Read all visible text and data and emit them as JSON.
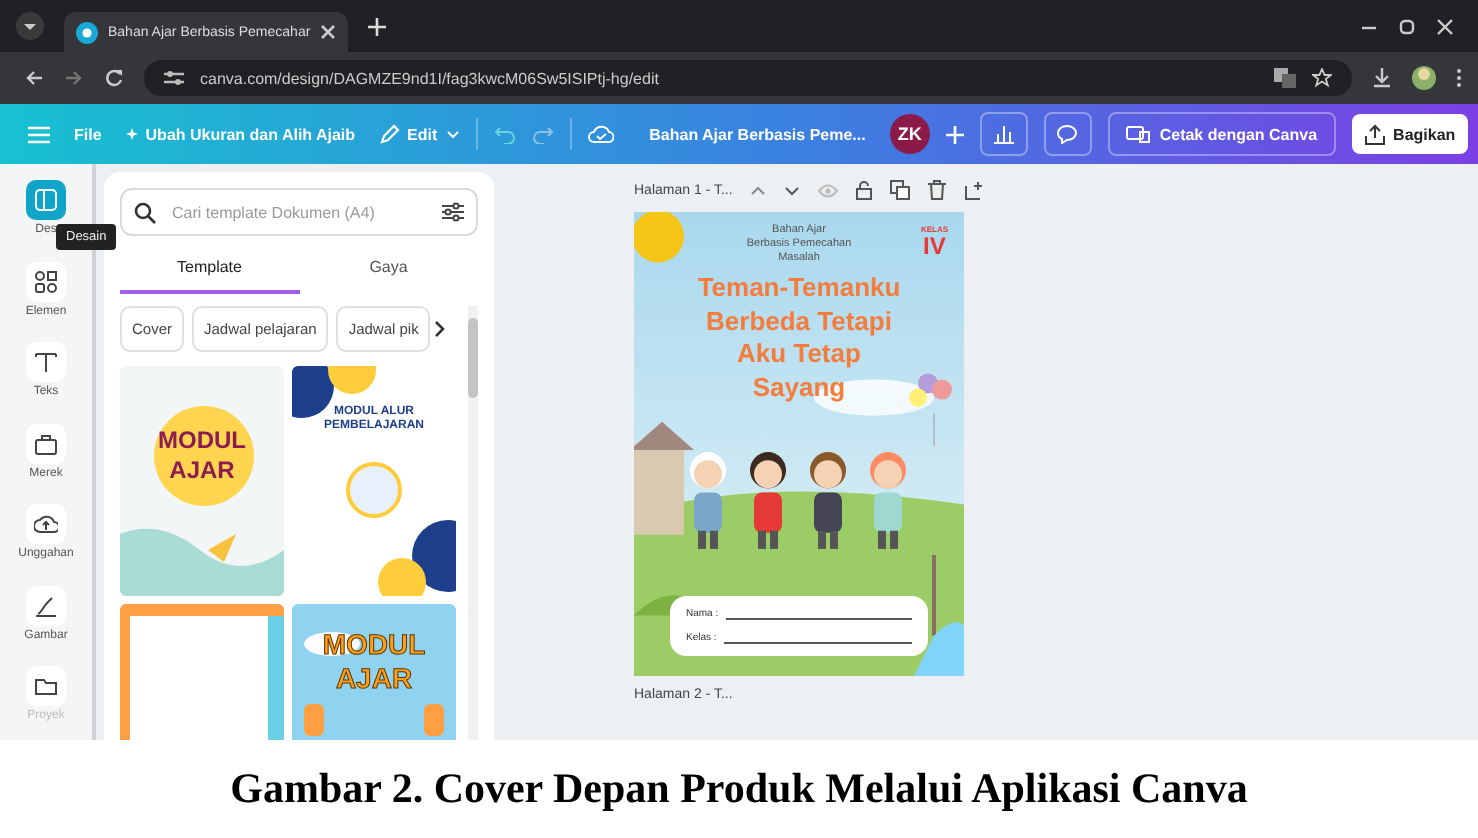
{
  "browser": {
    "tab_title": "Bahan Ajar Berbasis Pemecahar",
    "url": "canva.com/design/DAGMZE9nd1I/fag3kwcM06Sw5ISIPtj-hg/edit"
  },
  "toolbar": {
    "file": "File",
    "resize": "Ubah Ukuran dan Alih Ajaib",
    "edit": "Edit",
    "doc_title": "Bahan Ajar Berbasis Peme...",
    "avatar": "ZK",
    "print_button": "Cetak dengan Canva",
    "share_button": "Bagikan"
  },
  "rail": {
    "tooltip": "Desain",
    "items": [
      {
        "kind": "design",
        "label": "Des",
        "selected": true
      },
      {
        "kind": "elements",
        "label": "Elemen",
        "selected": false
      },
      {
        "kind": "text",
        "label": "Teks",
        "selected": false
      },
      {
        "kind": "brand",
        "label": "Merek",
        "selected": false
      },
      {
        "kind": "upload",
        "label": "Unggahan",
        "selected": false
      },
      {
        "kind": "draw",
        "label": "Gambar",
        "selected": false
      },
      {
        "kind": "folder",
        "label": "Proyek",
        "selected": false
      }
    ]
  },
  "panel": {
    "search": {
      "placeholder": "Cari template Dokumen (A4)"
    },
    "tabs": [
      {
        "label": "Template",
        "selected": true
      },
      {
        "label": "Gaya",
        "selected": false
      }
    ],
    "chips": [
      "Cover",
      "Jadwal pelajaran",
      "Jadwal pik"
    ],
    "templates": [
      {
        "kind": "mint",
        "lines": [
          "MODUL",
          "AJAR"
        ]
      },
      {
        "kind": "navy",
        "lines": [
          "MODUL ALUR",
          "PEMBELAJARAN"
        ]
      },
      {
        "kind": "blank"
      },
      {
        "kind": "sky",
        "lines": [
          "MODUL",
          "AJAR"
        ]
      }
    ]
  },
  "pages": [
    {
      "label": "Halaman 1 - T..."
    },
    {
      "label": "Halaman 2 - T..."
    }
  ],
  "cover": {
    "subtitle": [
      "Bahan Ajar",
      "Berbasis Pemecahan",
      "Masalah"
    ],
    "class_label": "KELAS",
    "class": "IV",
    "title": [
      "Teman-Temanku",
      "Berbeda Tetapi",
      "Aku Tetap",
      "Sayang"
    ],
    "fields": [
      "Nama :",
      "Kelas :"
    ]
  },
  "caption": "Gambar 2. Cover Depan Produk Melalui Aplikasi Canva"
}
